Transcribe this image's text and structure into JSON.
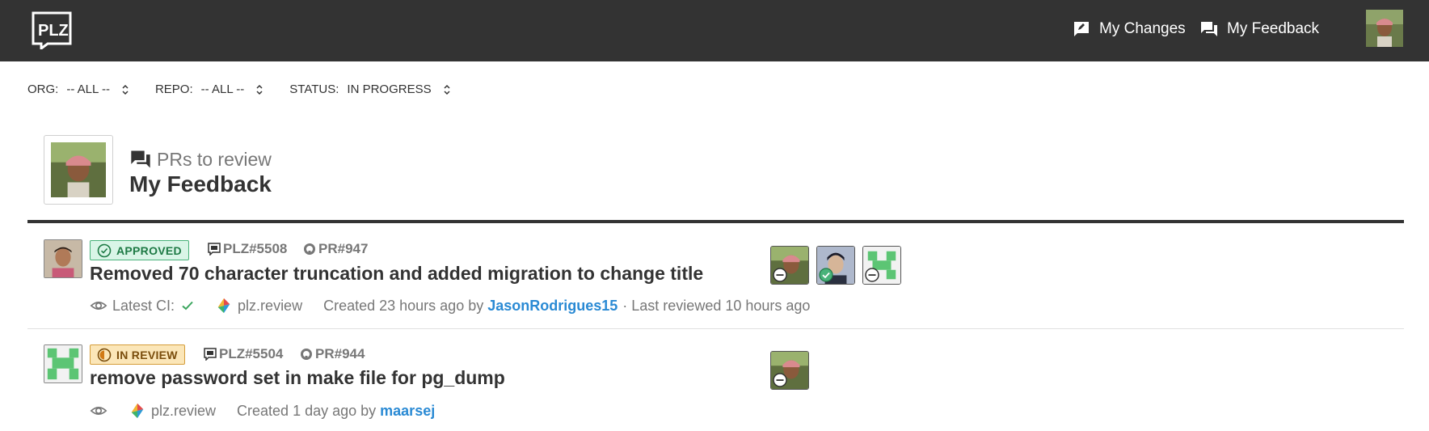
{
  "topbar": {
    "nav": [
      {
        "label": "My Changes",
        "icon": "edit-comment-icon"
      },
      {
        "label": "My Feedback",
        "icon": "forum-icon"
      }
    ]
  },
  "filters": [
    {
      "label": "ORG:",
      "value": "-- ALL --"
    },
    {
      "label": "REPO:",
      "value": "-- ALL --"
    },
    {
      "label": "STATUS:",
      "value": "IN PROGRESS"
    }
  ],
  "heading": {
    "subtitle": "PRs to review",
    "title": "My Feedback"
  },
  "colors": {
    "topbar": "#333333",
    "approved": "#1e7a45",
    "in_review": "#7a4d0c",
    "link": "#2a8ad4"
  },
  "rows": [
    {
      "status": "APPROVED",
      "plz_ref": "PLZ#5508",
      "pr_ref": "PR#947",
      "title": "Removed 70 character truncation and added migration to change title t…",
      "ci_label": "Latest CI:",
      "repo": "plz.review",
      "created": "Created 23 hours ago by",
      "author": "JasonRodrigues15",
      "last_reviewed": "· Last reviewed 10 hours ago",
      "reviewers": [
        {
          "avatar": "photo",
          "state": "minus"
        },
        {
          "avatar": "photo",
          "state": "approved"
        },
        {
          "avatar": "identicon",
          "state": "minus"
        }
      ]
    },
    {
      "status": "IN REVIEW",
      "plz_ref": "PLZ#5504",
      "pr_ref": "PR#944",
      "title": "remove password set in make file for pg_dump",
      "repo": "plz.review",
      "created": "Created 1 day ago by",
      "author": "maarsej",
      "reviewers": [
        {
          "avatar": "photo",
          "state": "minus"
        }
      ]
    }
  ]
}
